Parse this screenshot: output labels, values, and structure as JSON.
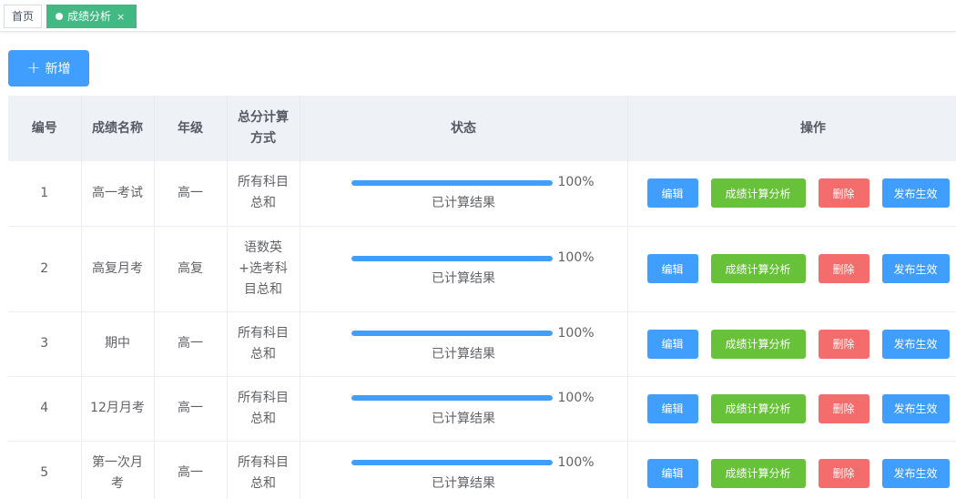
{
  "tabs": [
    {
      "label": "首页",
      "active": false
    },
    {
      "label": "成绩分析",
      "active": true,
      "close": "×"
    }
  ],
  "toolbar": {
    "add_label": "新增",
    "add_icon": "+"
  },
  "colors": {
    "primary": "#409eff",
    "success": "#67c23a",
    "danger": "#f56c6c",
    "tab_active": "#42b983",
    "header_bg": "#eef1f6"
  },
  "table": {
    "headers": [
      "编号",
      "成绩名称",
      "年级",
      "总分计算方式",
      "状态",
      "操作"
    ],
    "rows": [
      {
        "id": "1",
        "name": "高一考试",
        "grade": "高一",
        "method": "所有科目总和",
        "progress": "100%",
        "progress_value": 100,
        "status": "已计算结果"
      },
      {
        "id": "2",
        "name": "高复月考",
        "grade": "高复",
        "method": "语数英+选考科目总和",
        "progress": "100%",
        "progress_value": 100,
        "status": "已计算结果"
      },
      {
        "id": "3",
        "name": "期中",
        "grade": "高一",
        "method": "所有科目总和",
        "progress": "100%",
        "progress_value": 100,
        "status": "已计算结果"
      },
      {
        "id": "4",
        "name": "12月月考",
        "grade": "高一",
        "method": "所有科目总和",
        "progress": "100%",
        "progress_value": 100,
        "status": "已计算结果"
      },
      {
        "id": "5",
        "name": "第一次月考",
        "grade": "高一",
        "method": "所有科目总和",
        "progress": "100%",
        "progress_value": 100,
        "status": "已计算结果"
      }
    ],
    "actions": {
      "edit": "编辑",
      "analysis": "成绩计算分析",
      "delete": "删除",
      "publish": "发布生效"
    }
  }
}
